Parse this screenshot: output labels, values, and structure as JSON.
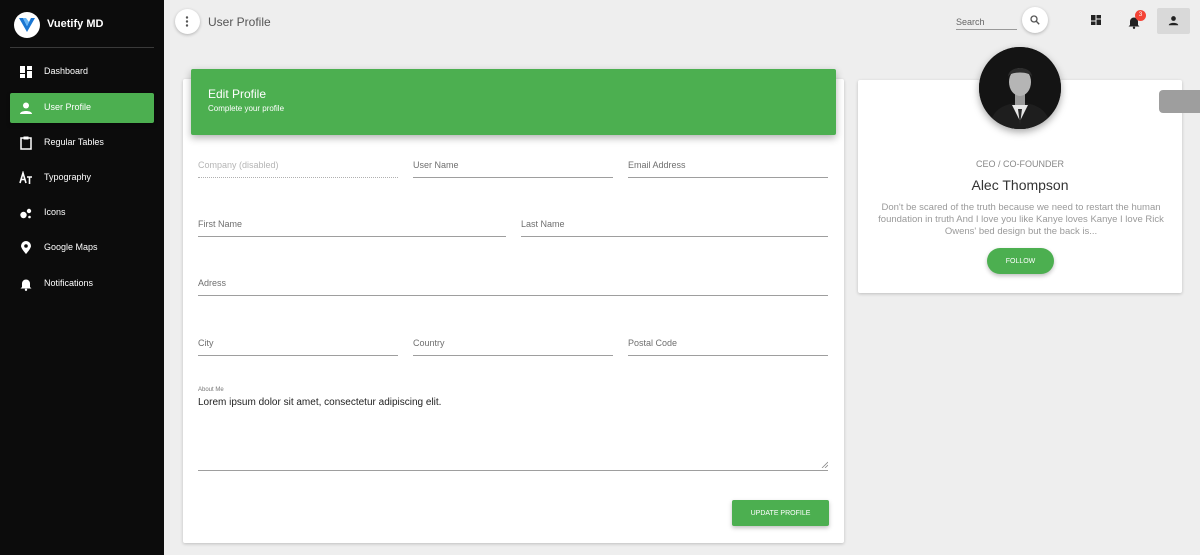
{
  "brand": {
    "name": "Vuetify MD",
    "logo_letter": "V"
  },
  "sidebar": {
    "items": [
      {
        "label": "Dashboard",
        "icon": "dashboard-icon",
        "active": false
      },
      {
        "label": "User Profile",
        "icon": "person-icon",
        "active": true
      },
      {
        "label": "Regular Tables",
        "icon": "clipboard-icon",
        "active": false
      },
      {
        "label": "Typography",
        "icon": "typography-icon",
        "active": false
      },
      {
        "label": "Icons",
        "icon": "bubbles-icon",
        "active": false
      },
      {
        "label": "Google Maps",
        "icon": "map-pin-icon",
        "active": false
      },
      {
        "label": "Notifications",
        "icon": "bell-icon",
        "active": false
      }
    ]
  },
  "toolbar": {
    "title": "User Profile",
    "search_placeholder": "Search",
    "notification_count": "3"
  },
  "edit_profile": {
    "title": "Edit Profile",
    "subtitle": "Complete your profile",
    "fields": {
      "company": {
        "placeholder": "Company (disabled)",
        "value": ""
      },
      "username": {
        "placeholder": "User Name",
        "value": ""
      },
      "email": {
        "placeholder": "Email Address",
        "value": ""
      },
      "first_name": {
        "placeholder": "First Name",
        "value": ""
      },
      "last_name": {
        "placeholder": "Last Name",
        "value": ""
      },
      "address": {
        "placeholder": "Adress",
        "value": ""
      },
      "city": {
        "placeholder": "City",
        "value": ""
      },
      "country": {
        "placeholder": "Country",
        "value": ""
      },
      "postal_code": {
        "placeholder": "Postal Code",
        "value": ""
      }
    },
    "about_label": "About Me",
    "about_value": "Lorem ipsum dolor sit amet, consectetur adipiscing elit.",
    "update_button": "UPDATE PROFILE"
  },
  "profile_card": {
    "role": "CEO / CO-FOUNDER",
    "name": "Alec Thompson",
    "bio": "Don't be scared of the truth because we need to restart the human foundation in truth And I love you like Kanye loves Kanye I love Rick Owens' bed design but the back is...",
    "follow_button": "FOLLOW"
  },
  "colors": {
    "accent": "#4caf50",
    "sidebar_bg": "#0c0c0c",
    "page_bg": "#eeeeee",
    "badge": "#f44336"
  }
}
